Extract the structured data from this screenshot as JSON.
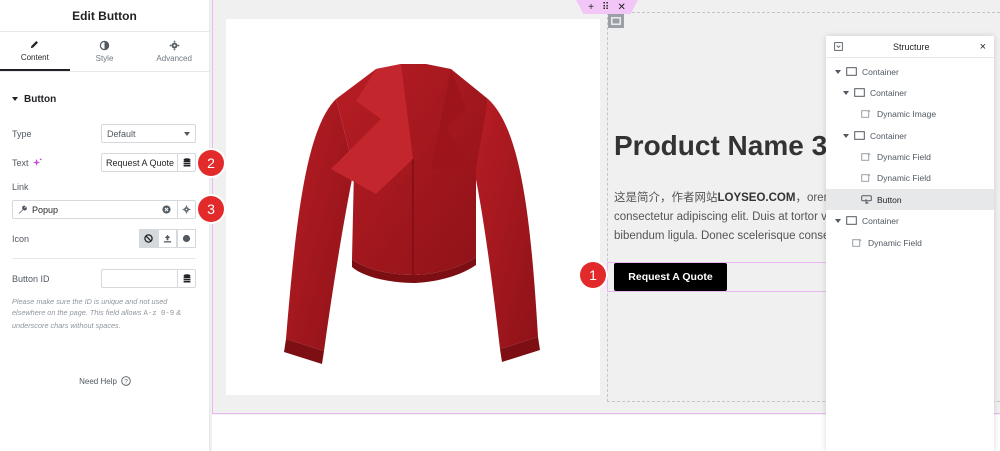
{
  "panel": {
    "title": "Edit Button",
    "tabs": [
      {
        "label": "Content",
        "icon": "pencil-icon"
      },
      {
        "label": "Style",
        "icon": "half-circle-icon"
      },
      {
        "label": "Advanced",
        "icon": "gear-icon"
      }
    ],
    "section": "Button",
    "type_label": "Type",
    "type_value": "Default",
    "text_label": "Text",
    "text_value": "Request A Quote",
    "link_label": "Link",
    "link_value": "Popup",
    "icon_label": "Icon",
    "button_id_label": "Button ID",
    "button_id_value": "",
    "help_part1": "Please make sure the ID is unique and not used elsewhere on the page. This field allows",
    "help_code": "A-z 0-9",
    "help_part2": "& underscore chars without spaces.",
    "need_help": "Need Help"
  },
  "badges": [
    "1",
    "2",
    "3"
  ],
  "canvas": {
    "product_title": "Product Name 3",
    "desc_line1_a": "这是简介，作者网站",
    "desc_line1_b": "LOYSEO.COM",
    "desc_line1_c": "，orem",
    "desc_line2": "consectetur adipiscing elit. Duis at tortor vi",
    "desc_line3": "bibendum ligula. Donec scelerisque consect",
    "button_label": "Request A Quote",
    "handle_icons": [
      "plus-icon",
      "grip-icon",
      "close-icon"
    ],
    "accent_color": "#e9b7f2",
    "badge_color": "#e32a2a",
    "jacket_color": "#a3161c"
  },
  "structure": {
    "title": "Structure",
    "items": [
      {
        "label": "Container",
        "icon": "container-icon"
      },
      {
        "label": "Container",
        "icon": "container-icon"
      },
      {
        "label": "Dynamic Image",
        "icon": "dynamic-image-icon"
      },
      {
        "label": "Container",
        "icon": "container-icon"
      },
      {
        "label": "Dynamic Field",
        "icon": "dynamic-field-icon"
      },
      {
        "label": "Dynamic Field",
        "icon": "dynamic-field-icon"
      },
      {
        "label": "Button",
        "icon": "button-icon"
      },
      {
        "label": "Container",
        "icon": "container-icon"
      },
      {
        "label": "Dynamic Field",
        "icon": "dynamic-field-icon"
      }
    ]
  }
}
